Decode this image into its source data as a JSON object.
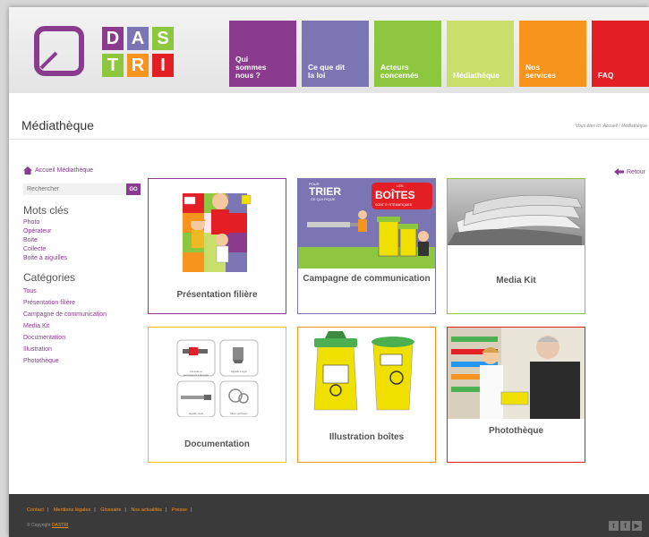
{
  "logo": {
    "letters": [
      "D",
      "A",
      "S",
      "T",
      "R",
      "I"
    ],
    "colors": [
      "#8a3b8e",
      "#7c75b3",
      "#8dc63f",
      "#8dc63f",
      "#f7941d",
      "#e31e24"
    ]
  },
  "nav": [
    {
      "label": "Qui\nsommes\nnous ?",
      "color": "#8a3b8e"
    },
    {
      "label": "Ce que dit\nla loi",
      "color": "#7c75b3"
    },
    {
      "label": "Acteurs\nconcernés",
      "color": "#8dc63f"
    },
    {
      "label": "Médiathèque",
      "color": "#c9df6c"
    },
    {
      "label": "Nos\nservices",
      "color": "#f7941d"
    },
    {
      "label": "FAQ",
      "color": "#e31e24"
    }
  ],
  "page": {
    "title": "Médiathèque",
    "breadcrumb": "Vous êtes ici :Accueil / Médiathèque"
  },
  "sidebar": {
    "home_link": "Accueil Médiathèque",
    "search_placeholder": "Rechercher",
    "go_label": "GO",
    "keywords_heading": "Mots clés",
    "keywords": [
      "Photo",
      "Opérateur",
      "Boite",
      "Collecte",
      "Boite à aiguilles"
    ],
    "categories_heading": "Catégories",
    "categories": [
      "Tous",
      "Présentation filière",
      "Campagne de communication",
      "Media Kit",
      "Documentation",
      "Illustration",
      "Photothèque"
    ]
  },
  "back_label": "Retour",
  "tiles": [
    {
      "label": "Présentation filière",
      "border": "#8a3b8e"
    },
    {
      "label": "Campagne de communication",
      "border": "#7c75b3"
    },
    {
      "label": "Media Kit",
      "border": "#8dc63f"
    },
    {
      "label": "Documentation",
      "border": "#e8c300"
    },
    {
      "label": "Illustration boîtes",
      "border": "#f7941d"
    },
    {
      "label": "Photothèque",
      "border": "#e31e24"
    }
  ],
  "campaign": {
    "pour": "POUR",
    "trier": "TRIER",
    "ce_qui_pique": "CE QUI PIQUE",
    "les": "LES",
    "boites": "BOÎTES",
    "systematiques": "SONT SYSTÉMATIQUES"
  },
  "doc_icons": {
    "lancette": "Lancette et\nperforateurs à lancette",
    "aiguille_stylo": "Aiguille à stylo",
    "aiguille_seule": "Aiguille seule",
    "micro": "Micro-perfuseur"
  },
  "footer": {
    "links": [
      "Contact",
      "Mentions légales",
      "Glossaire",
      "Nos actualités",
      "Presse"
    ],
    "copyright_prefix": "© Copyright",
    "copyright_owner": "DASTRI"
  }
}
